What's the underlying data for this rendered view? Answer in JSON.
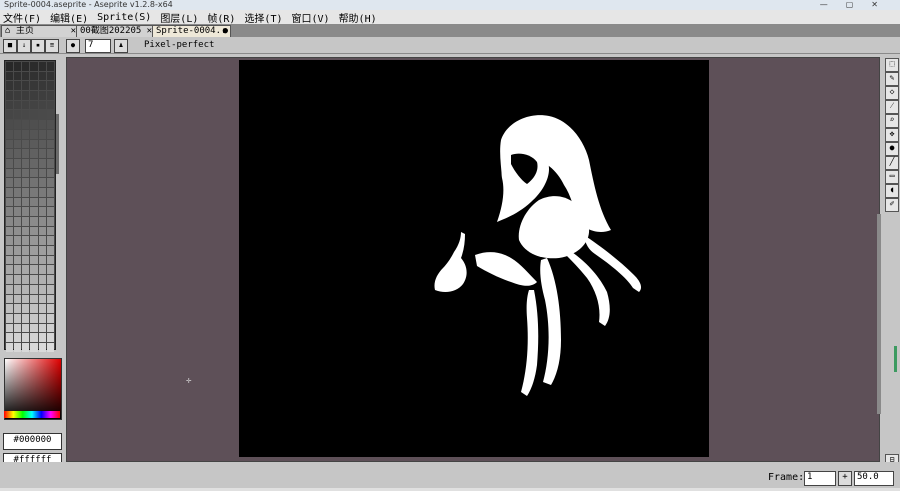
{
  "window": {
    "title": "Sprite-0004.aseprite - Aseprite v1.2.8-x64",
    "controls": [
      "—",
      "▢",
      "✕"
    ]
  },
  "menu": [
    "文件(F)",
    "编辑(E)",
    "Sprite(S)",
    "图层(L)",
    "帧(R)",
    "选择(T)",
    "窗口(V)",
    "帮助(H)"
  ],
  "tabs": [
    {
      "label": "主页",
      "close": "✕"
    },
    {
      "label": "00截图202205",
      "close": "✕"
    },
    {
      "label": "Sprite-0004.:",
      "close": "●"
    }
  ],
  "toolbar": {
    "brush_size": "7",
    "pixel_perfect_label": "Pixel-perfect"
  },
  "colors": {
    "foreground_hex": "#000000",
    "background_hex": "#ffffff",
    "canvas_bg": "#5e5058",
    "sprite_bg": "#000000",
    "palette_highlight": "#3c9a60"
  },
  "status": {
    "frame_label": "Frame:",
    "frame_value": "1",
    "frame_plus": "+",
    "zoom_value": "50.0"
  },
  "icons": {
    "canvas_cursor": "crosshair-icon"
  }
}
